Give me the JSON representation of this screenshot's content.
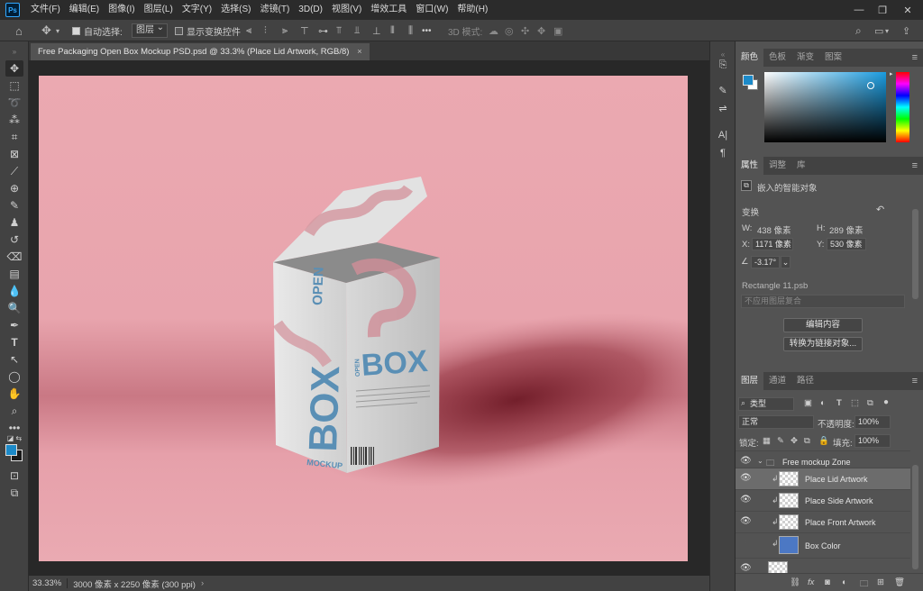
{
  "app": {
    "logo": "Ps"
  },
  "menubar": {
    "items": [
      "文件(F)",
      "编辑(E)",
      "图像(I)",
      "图层(L)",
      "文字(Y)",
      "选择(S)",
      "滤镜(T)",
      "3D(D)",
      "视图(V)",
      "增效工具",
      "窗口(W)",
      "帮助(H)"
    ],
    "window_controls": [
      "minimize-icon",
      "restore-icon",
      "close-icon"
    ]
  },
  "options": {
    "auto_select_label": "自动选择:",
    "auto_select_target": "图层",
    "show_transform_label": "显示变换控件",
    "mode_3d_label": "3D 模式:",
    "more": "•••"
  },
  "document": {
    "tab_title": "Free Packaging Open Box Mockup PSD.psd @ 33.3% (Place Lid Artwork, RGB/8)",
    "tab_close": "×",
    "zoom": "33.33%",
    "dimensions": "3000 像素 x 2250 像素 (300 ppi)"
  },
  "color_panel": {
    "tabs": [
      "颜色",
      "色板",
      "渐变",
      "图案"
    ],
    "foreground": "#1c8ac9",
    "background": "#ffffff"
  },
  "properties_panel": {
    "tabs": [
      "属性",
      "调整",
      "库"
    ],
    "object_type": "嵌入的智能对象",
    "section_transform": "变换",
    "w_label": "W:",
    "w_value": "438 像素",
    "h_label": "H:",
    "h_value": "289 像素",
    "x_label": "X:",
    "x_value": "1171 像素",
    "y_label": "Y:",
    "y_value": "530 像素",
    "angle_value": "-3.17°",
    "linked_file": "Rectangle 11.psb",
    "layer_comp_placeholder": "不应用图层复合",
    "edit_contents_button": "编辑内容",
    "convert_linked_button": "转换为链接对象..."
  },
  "layers_panel": {
    "tabs": [
      "图层",
      "通道",
      "路径"
    ],
    "filter_kind": "类型",
    "blend_mode": "正常",
    "opacity_label": "不透明度:",
    "opacity_value": "100%",
    "lock_label": "锁定:",
    "fill_label": "填充:",
    "fill_value": "100%",
    "layers": [
      {
        "name": "Free mockup Zone",
        "type": "group",
        "visible": true
      },
      {
        "name": "Place Lid Artwork",
        "type": "smart",
        "visible": true,
        "selected": true
      },
      {
        "name": "Place Side Artwork",
        "type": "smart",
        "visible": true
      },
      {
        "name": "Place Front Artwork",
        "type": "smart",
        "visible": true
      },
      {
        "name": "Box Color",
        "type": "fill",
        "visible": false,
        "color": "#4c78c4"
      }
    ],
    "footer_icons": [
      "link-icon",
      "fx-icon",
      "mask-icon",
      "adjustment-icon",
      "folder-icon",
      "new-layer-icon",
      "trash-icon"
    ]
  },
  "artwork": {
    "background_color": "#eba9b1",
    "box_word": "BOX",
    "open_word": "OPEN",
    "mockup_word": "MOCKUP",
    "accent_color": "#5a8fb5"
  }
}
